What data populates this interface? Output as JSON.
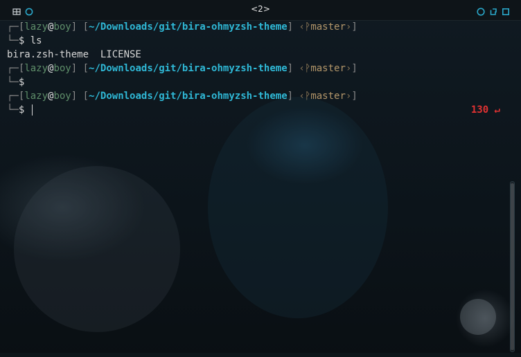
{
  "window": {
    "title": "<2>",
    "icons": [
      "tile-icon",
      "circle-icon",
      "app-menu-icon",
      "restore-icon",
      "maximize-icon"
    ]
  },
  "prompt": {
    "user": "lazy",
    "at": "@",
    "host": "boy",
    "path": "~/Downloads/git/bira-ohmyzsh-theme",
    "branch_symbol": "ᚹ",
    "branch": "master",
    "symbol": "$"
  },
  "lines": [
    {
      "type": "prompt",
      "command": "ls"
    },
    {
      "type": "output",
      "text": "bira.zsh-theme  LICENSE"
    },
    {
      "type": "prompt",
      "command": ""
    },
    {
      "type": "prompt",
      "command": "",
      "active": true
    }
  ],
  "status": {
    "exit_code": "130 ↵"
  },
  "colors": {
    "path": "#2fb8d6",
    "user_host": "#5f8f6a",
    "branch": "#b4976a",
    "error": "#e03232",
    "accent": "#2aa7c9"
  }
}
